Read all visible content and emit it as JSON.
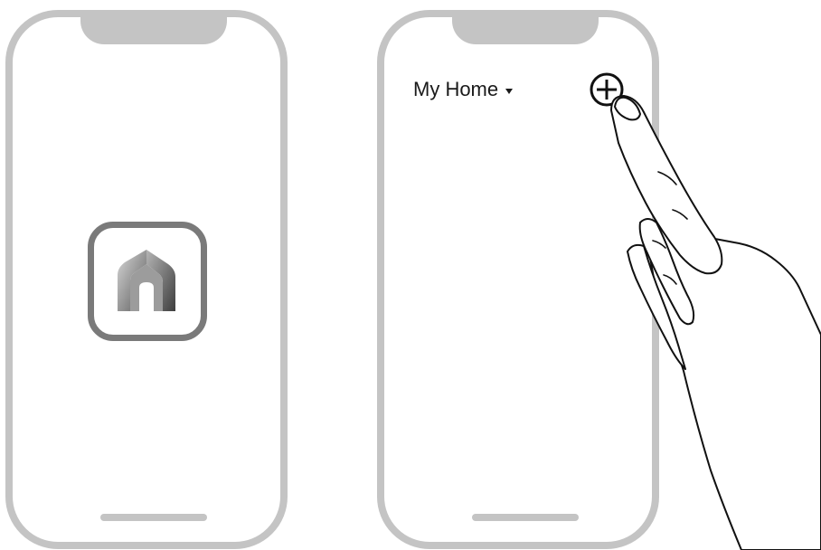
{
  "header": {
    "home_selector_label": "My Home"
  },
  "icons": {
    "app_logo": "house-logo-icon",
    "add": "plus-circle-icon",
    "dropdown": "caret-down-icon",
    "hand": "pointing-hand-icon"
  },
  "colors": {
    "phone_frame": "#c4c4c4",
    "icon_frame": "#7a7a7a",
    "text": "#1a1a1a"
  }
}
